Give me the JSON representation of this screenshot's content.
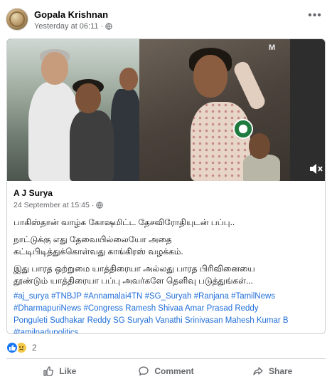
{
  "post": {
    "author": "Gopala Krishnan",
    "timestamp": "Yesterday at 06:11",
    "audience_icon": "globe-icon",
    "more_icon": "more-options-icon"
  },
  "shared_post": {
    "video": {
      "watermark": "M",
      "mute_icon": "speaker-muted-icon"
    },
    "author": "A J Surya",
    "timestamp": "24 September at 15:45",
    "audience_icon": "globe-icon",
    "paragraphs": [
      "பாகிஸ்தான் வாழ்க கோஷமிட்ட தேசவிரோதியுடன் பப்பு..",
      "நாட்டுக்கு எது தேவையில்லையோ அதை",
      "கட்டிபிடித்துக்கொள்வது காங்கிரஸ் வழக்கம்.",
      "இது பாரத ஒற்றுமை யாத்திரையா அல்லது பாரத பிரிவினையை",
      "தூண்டும் யாத்திரையா பப்பு அவர்களே தெளிவு படுத்துங்கள்..."
    ],
    "hashtags": [
      "#aj_surya",
      "#TNBJP",
      "#Annamalai4TN",
      "#SG_Suryah",
      "#Ranjana",
      "#TamilNews",
      "#DharmapuriNews",
      "#Congress",
      "Ramesh Shivaa",
      "Amar Prasad Reddy",
      "Ponguleti Sudhakar Reddy",
      "SG Suryah",
      "Vanathi Srinivasan",
      "Mahesh Kumar B",
      "#tamilnadupolitics"
    ]
  },
  "reactions": {
    "icons": [
      "like-reaction-icon",
      "sad-reaction-icon"
    ],
    "count": "2"
  },
  "actions": {
    "like": "Like",
    "comment": "Comment",
    "share": "Share"
  },
  "colors": {
    "link": "#216fdb",
    "secondary_text": "#65676b",
    "like_blue": "#1877f2",
    "border": "#ced0d4"
  }
}
